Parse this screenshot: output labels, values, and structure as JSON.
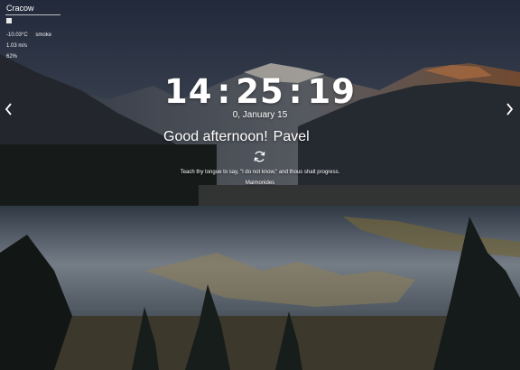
{
  "weather": {
    "city_value": "Cracow",
    "temperature": "-10.03°C",
    "description": "smoke",
    "wind": "1.03 m/s",
    "humidity": "62%",
    "icon": "weather-icon"
  },
  "clock": {
    "hours": "14",
    "minutes": "25",
    "seconds": "19",
    "separator": ":"
  },
  "date": "0, January 15",
  "greeting": {
    "text": "Good afternoon!",
    "name": "Pavel"
  },
  "quote": {
    "text": "Teach thy tongue to say, \"I do not know,\" and thous shalt progress.",
    "author": "Maimonides"
  },
  "navigation": {
    "prev_icon": "chevron-left-icon",
    "next_icon": "chevron-right-icon",
    "refresh_icon": "refresh-icon"
  }
}
